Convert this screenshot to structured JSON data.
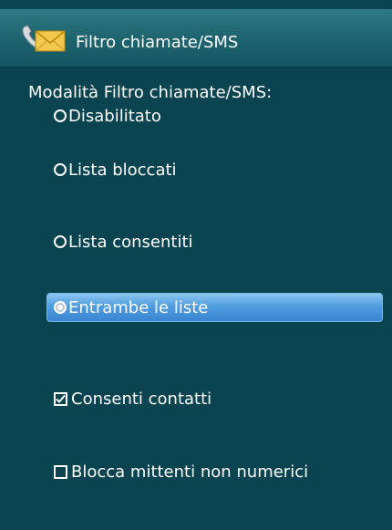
{
  "title": "Filtro chiamate/SMS",
  "mode_label": "Modalità Filtro chiamate/SMS:",
  "radio_options": [
    {
      "label": "Disabilitato",
      "selected": false
    },
    {
      "label": "Lista bloccati",
      "selected": false
    },
    {
      "label": "Lista consentiti",
      "selected": false
    },
    {
      "label": "Entrambe le liste",
      "selected": true
    }
  ],
  "checkboxes": [
    {
      "label": "Consenti contatti",
      "checked": true
    },
    {
      "label": "Blocca mittenti non numerici",
      "checked": false
    }
  ],
  "colors": {
    "background": "#0b4451",
    "highlight": "#4f9de0",
    "text": "#ffffff"
  },
  "icon": "phone-envelope-icon"
}
